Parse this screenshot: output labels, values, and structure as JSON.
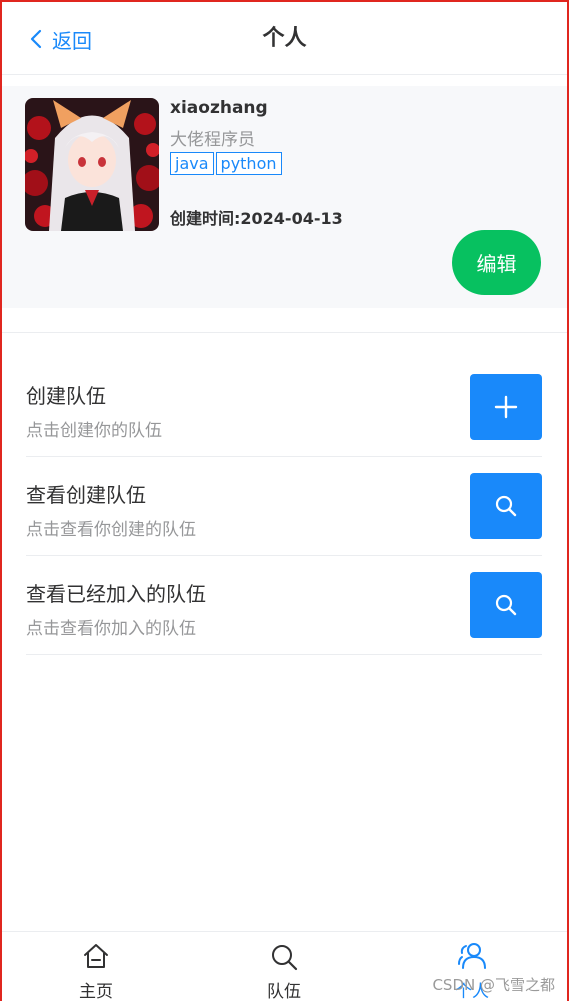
{
  "nav": {
    "back_label": "返回",
    "title": "个人"
  },
  "profile": {
    "username": "xiaozhang",
    "profile": "大佬程序员",
    "tags": [
      "java",
      "python"
    ],
    "created": "创建时间:2024-04-13",
    "edit_label": "编辑"
  },
  "actions": [
    {
      "title": "创建队伍",
      "desc": "点击创建你的队伍",
      "icon": "plus-icon"
    },
    {
      "title": "查看创建队伍",
      "desc": "点击查看你创建的队伍",
      "icon": "search-icon"
    },
    {
      "title": "查看已经加入的队伍",
      "desc": "点击查看你加入的队伍",
      "icon": "search-icon"
    }
  ],
  "tabbar": [
    {
      "label": "主页",
      "icon": "home-icon",
      "active": false
    },
    {
      "label": "队伍",
      "icon": "search-icon",
      "active": false
    },
    {
      "label": "个人",
      "icon": "friends-icon",
      "active": true
    }
  ],
  "watermark": "CSDN @飞雪之都",
  "colors": {
    "primary": "#1989fa",
    "success": "#07c160",
    "text": "#323233",
    "muted": "#969799",
    "card_bg": "#f7f8fa"
  }
}
